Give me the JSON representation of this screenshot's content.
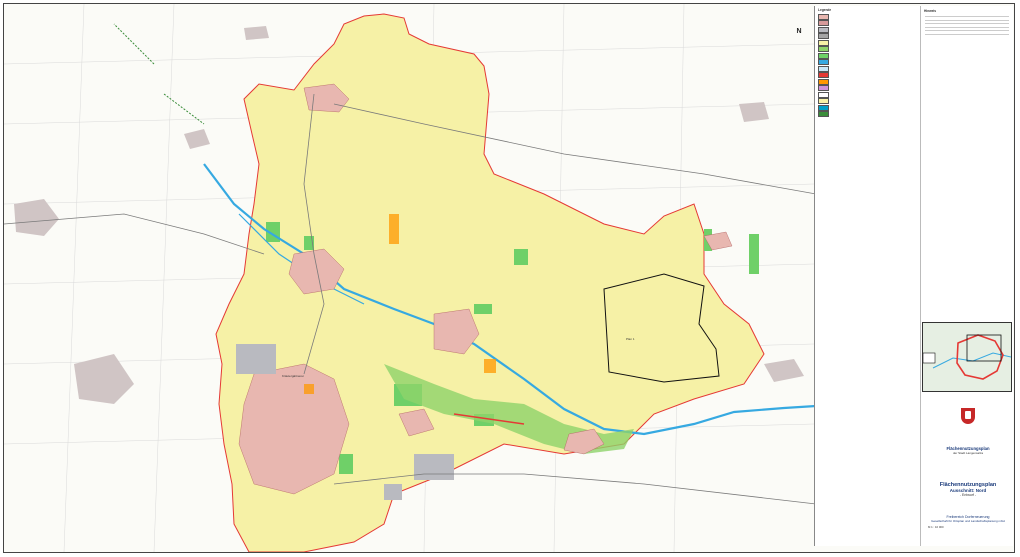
{
  "map": {
    "north_arrow": "N",
    "colors": {
      "agriculture": "#f6f1a6",
      "settlement": "#e8b7b0",
      "commercial": "#b9bac0",
      "forest": "#6fd068",
      "water": "#36a9e1",
      "green_space": "#8ed36a",
      "municipal_border": "#e53935",
      "outside": "#ffffff"
    },
    "place_labels": [
      "Plan 1",
      "Kräutergärtnerei"
    ]
  },
  "legend": {
    "heading": "Legende",
    "rows": [
      {
        "label": "",
        "color": "#e8b7b0"
      },
      {
        "label": "",
        "color": "#d69a9a"
      },
      {
        "label": "",
        "color": "#b9bac0"
      },
      {
        "label": "",
        "color": "#a4a4a4"
      },
      {
        "label": "",
        "color": "#f6f1a6"
      },
      {
        "label": "",
        "color": "#8ed36a"
      },
      {
        "label": "",
        "color": "#6fd068"
      },
      {
        "label": "",
        "color": "#36a9e1"
      },
      {
        "label": "",
        "color": "#c9e7f7"
      },
      {
        "label": "",
        "color": "#e53935"
      },
      {
        "label": "",
        "color": "#ff9800"
      },
      {
        "label": "",
        "color": "#ce93d8"
      },
      {
        "label": "",
        "color": "#ffffff"
      },
      {
        "label": "",
        "color": "#f6f1a6"
      },
      {
        "label": "",
        "color": "#00a0c8"
      },
      {
        "label": "",
        "color": "#3a8d3a"
      }
    ]
  },
  "title_block": {
    "plan_name": "Flächennutzungsplan",
    "plan_sub": "der Stadt Langensalza",
    "main": "Flächennutzungsplan",
    "section": "Ausschnitt: Nord",
    "extract": "- Entwurf -",
    "org": "Freibereich Dorferneuerung",
    "org2": "Gesellschaft für Ortsplan und Landschaftsplanung mbH",
    "scale": "M 1 : 10 000"
  },
  "notes": {
    "heading": "Hinweis"
  }
}
